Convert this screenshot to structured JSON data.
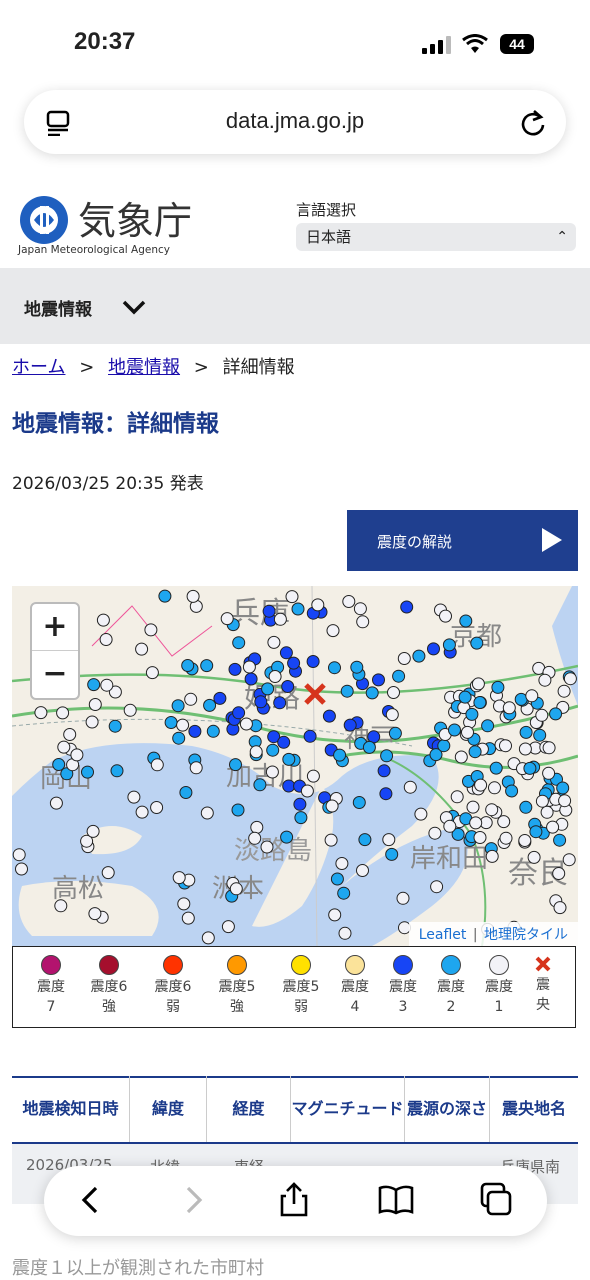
{
  "status": {
    "time": "20:37",
    "battery": "44"
  },
  "browser": {
    "url": "data.jma.go.jp"
  },
  "header": {
    "logo_text": "気象庁",
    "logo_subtitle": "Japan Meteorological Agency",
    "lang_label": "言語選択",
    "lang_value": "日本語"
  },
  "nav": {
    "label": "地震情報"
  },
  "breadcrumb": {
    "home": "ホーム",
    "sep1": ">",
    "quake": "地震情報",
    "sep2": ">",
    "current": "詳細情報"
  },
  "page": {
    "title": "地震情報：詳細情報",
    "issued": "2026/03/25 20:35 発表",
    "explain_button": "震度の解説"
  },
  "map": {
    "zoom_in": "+",
    "zoom_out": "−",
    "attribution_leaflet": "Leaflet",
    "attribution_sep": "|",
    "attribution_tile": "地理院タイル",
    "place_labels": [
      "兵庫",
      "京都",
      "姫路",
      "神戸",
      "岡山",
      "加古川",
      "淡路島",
      "高松",
      "洲本",
      "岸和田",
      "奈良"
    ]
  },
  "legend": [
    {
      "line1": "震度",
      "line2": "7",
      "color": "#b3136e"
    },
    {
      "line1": "震度6",
      "line2": "強",
      "color": "#a50f2d"
    },
    {
      "line1": "震度6",
      "line2": "弱",
      "color": "#ff3300"
    },
    {
      "line1": "震度5",
      "line2": "強",
      "color": "#ff9900"
    },
    {
      "line1": "震度5",
      "line2": "弱",
      "color": "#ffe100"
    },
    {
      "line1": "震度",
      "line2": "4",
      "color": "#fbe39a"
    },
    {
      "line1": "震度",
      "line2": "3",
      "color": "#1745f5"
    },
    {
      "line1": "震度",
      "line2": "2",
      "color": "#1ea6ef"
    },
    {
      "line1": "震度",
      "line2": "1",
      "color": "#f2f2f7"
    },
    {
      "line1": "震",
      "line2": "央",
      "color": "#d6341c"
    }
  ],
  "table": {
    "headers": [
      "地震検知日時",
      "緯度",
      "経度",
      "マグニチュード",
      "震源の深さ",
      "震央地名"
    ],
    "row": [
      "2026/03/25",
      "北緯",
      "東経",
      "",
      "",
      "兵庫県南部"
    ]
  },
  "footer_heading": "震度１以上が観測された市町村"
}
